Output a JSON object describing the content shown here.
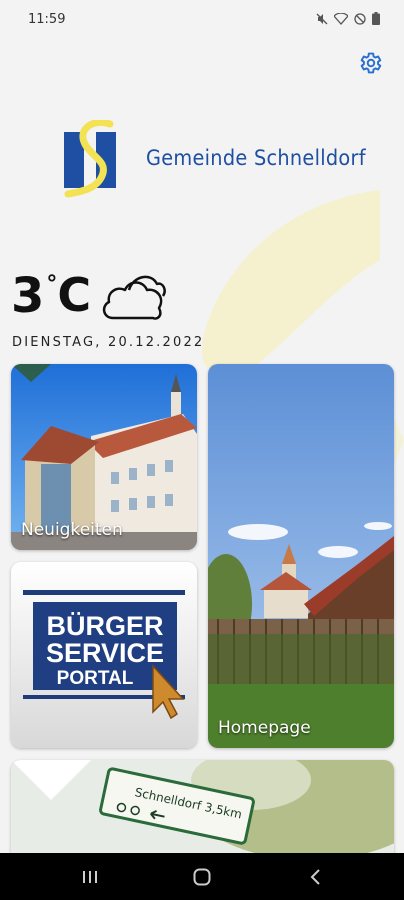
{
  "status_bar": {
    "time": "11:59",
    "icons": [
      "mute-icon",
      "wifi-icon",
      "do-not-disturb-icon",
      "battery-icon"
    ]
  },
  "header": {
    "settings_icon": "gear-icon",
    "brand_name": "Gemeinde Schnelldorf"
  },
  "weather": {
    "temperature": "3",
    "degree_symbol": "°",
    "unit": "C",
    "condition_icon": "cloud-icon",
    "date": "DIENSTAG, 20.12.2022"
  },
  "tiles": {
    "news": {
      "label": "Neuigkeiten"
    },
    "citizen_portal": {
      "logo_line1": "BÜRGER",
      "logo_line2": "SERVICE",
      "logo_line3": "PORTAL"
    },
    "homepage": {
      "label": "Homepage"
    },
    "signpost": {
      "sign_text": "Schnelldorf 3,5km"
    }
  },
  "nav_bar": {
    "buttons": [
      "recent-apps-icon",
      "home-icon",
      "back-icon"
    ]
  },
  "colors": {
    "brand_blue": "#1e4fa3",
    "brand_yellow": "#f3e254",
    "background": "#f3f3f3",
    "gear_blue": "#2a6fd0"
  }
}
